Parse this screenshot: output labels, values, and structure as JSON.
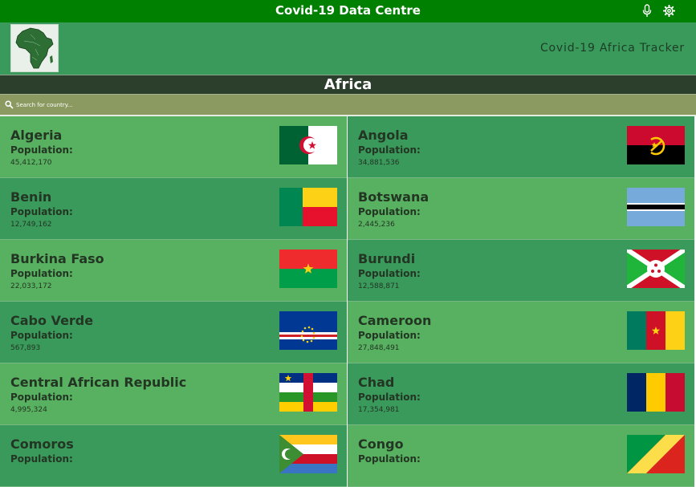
{
  "app": {
    "title": "Covid-19 Data Centre",
    "subtitle": "Covid-19 Africa Tracker"
  },
  "region": {
    "label": "Africa"
  },
  "search": {
    "placeholder": "Search for country..."
  },
  "countries": [
    {
      "name": "Algeria",
      "population_label": "Population:",
      "population": "45,412,170",
      "flag": "algeria-flag"
    },
    {
      "name": "Angola",
      "population_label": "Population:",
      "population": "34,881,536",
      "flag": "angola-flag"
    },
    {
      "name": "Benin",
      "population_label": "Population:",
      "population": "12,749,162",
      "flag": "benin-flag"
    },
    {
      "name": "Botswana",
      "population_label": "Population:",
      "population": "2,445,236",
      "flag": "botswana-flag"
    },
    {
      "name": "Burkina Faso",
      "population_label": "Population:",
      "population": "22,033,172",
      "flag": "burkina-faso-flag"
    },
    {
      "name": "Burundi",
      "population_label": "Population:",
      "population": "12,588,871",
      "flag": "burundi-flag"
    },
    {
      "name": "Cabo Verde",
      "population_label": "Population:",
      "population": "567,893",
      "flag": "cabo-verde-flag"
    },
    {
      "name": "Cameroon",
      "population_label": "Population:",
      "population": "27,848,491",
      "flag": "cameroon-flag"
    },
    {
      "name": "Central African Republic",
      "population_label": "Population:",
      "population": "4,995,324",
      "flag": "central-african-republic-flag"
    },
    {
      "name": "Chad",
      "population_label": "Population:",
      "population": "17,354,981",
      "flag": "chad-flag"
    },
    {
      "name": "Comoros",
      "population_label": "Population:",
      "population": "",
      "flag": "comoros-flag"
    },
    {
      "name": "Congo",
      "population_label": "Population:",
      "population": "",
      "flag": "congo-flag"
    }
  ],
  "colors": {
    "topbar": "#008000",
    "header": "#3a9a5c",
    "card_light": "#58b160",
    "card_dark": "#3a9a5c",
    "region_bar": "#2c3e2c",
    "search_bar": "#8b9a61"
  },
  "icons": {
    "microphone": "microphone-icon",
    "settings": "gear-icon",
    "search": "search-icon",
    "logo": "africa-map-logo"
  }
}
